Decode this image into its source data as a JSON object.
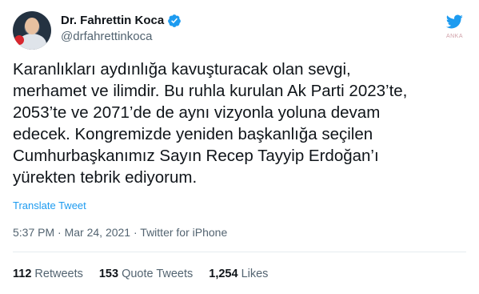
{
  "author": {
    "display_name": "Dr. Fahrettin Koca",
    "handle": "@drfahrettinkoca",
    "verified": true
  },
  "watermark": "ANKA",
  "tweet_text": "Karanlıkları aydınlığa kavuşturacak olan sevgi,\nmerhamet ve ilimdir. Bu ruhla kurulan Ak Parti 2023’te,\n2053’te ve 2071’de de aynı vizyonla yoluna devam\nedecek. Kongremizde yeniden başkanlığa seçilen\nCumhurbaşkanımız Sayın Recep Tayyip Erdoğan’ı\nyürekten tebrik ediyorum.",
  "translate_label": "Translate Tweet",
  "meta": {
    "time": "5:37 PM",
    "date": "Mar 24, 2021",
    "source": "Twitter for iPhone",
    "separator": "·"
  },
  "stats": {
    "retweets_count": "112",
    "retweets_label": "Retweets",
    "quotes_count": "153",
    "quotes_label": "Quote Tweets",
    "likes_count": "1,254",
    "likes_label": "Likes"
  },
  "colors": {
    "link": "#1d9bf0",
    "secondary_text": "#536471",
    "verified": "#1d9bf0"
  },
  "icons": {
    "verified": "verified-badge-icon",
    "logo": "twitter-bird-icon"
  }
}
